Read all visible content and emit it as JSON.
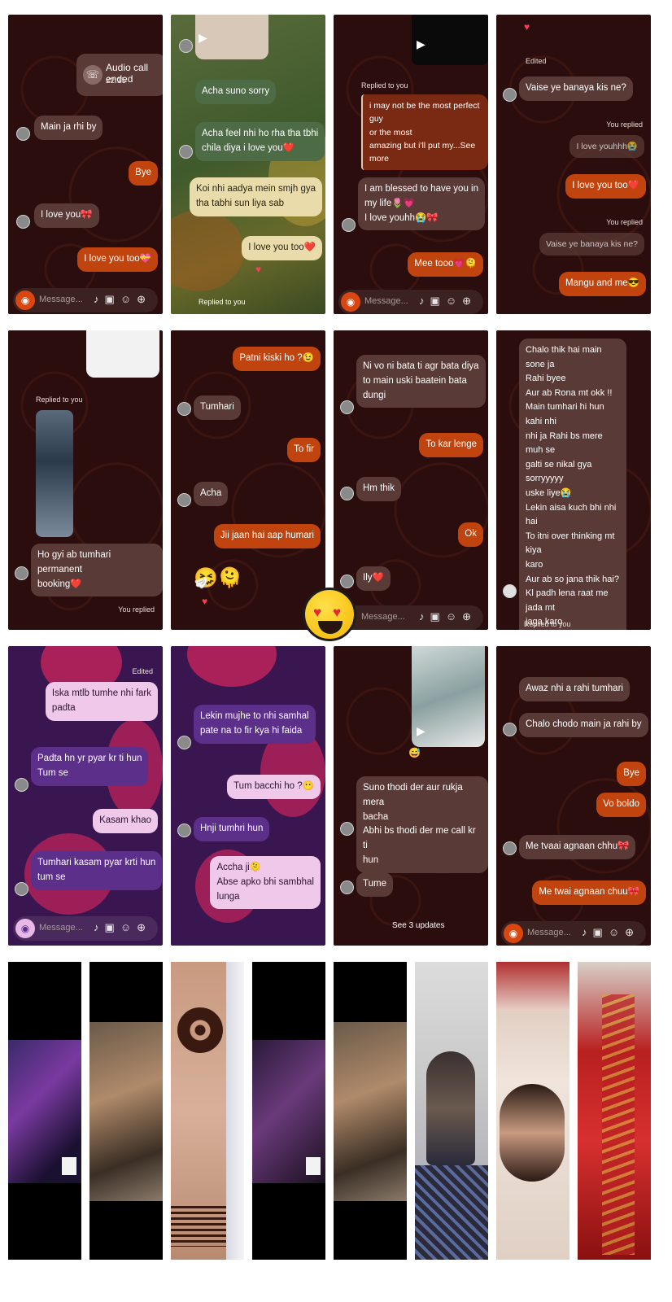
{
  "tile1": {
    "call_title": "Audio call ended",
    "call_time": "22:15",
    "m1": "Main ja rhi by",
    "m2": "Bye",
    "m3": "I love you🎀",
    "m4": "I love you too💝",
    "placeholder": "Message..."
  },
  "tile2": {
    "m1": "Acha suno sorry",
    "m2": "Acha feel nhi ho rha tha tbhi\nchila diya i love you❤️",
    "m3": "Koi nhi aadya mein smjh gya\ntha tabhi sun liya sab",
    "m4": "I love you too❤️",
    "replied": "Replied to you"
  },
  "tile3": {
    "replied": "Replied to you",
    "quote": "i may not be the most perfect guy\nor the most\namazing but i'll put my...See more",
    "m1": "I am blessed to have you in\nmy life🌷💗\nI love youhh😭🎀",
    "m2": "Mee tooo💗🫠",
    "placeholder": "Message..."
  },
  "tile4": {
    "edited": "Edited",
    "m1": "Vaise ye banaya kis ne?",
    "you_replied": "You replied",
    "q1": "I love youhhh😭",
    "m2": "I love you too❤️",
    "you_replied2": "You replied",
    "q2": "Vaise ye banaya kis ne?",
    "m3": "Mangu and me😎"
  },
  "tile5": {
    "replied": "Replied to you",
    "m1": "Ho gyi ab tumhari permanent\nbooking❤️",
    "you_replied": "You replied"
  },
  "tile6": {
    "m1": "Patni kiski ho ?😉",
    "m2": "Tumhari",
    "m3": "To fir",
    "m4": "Acha",
    "m5": "Jii jaan hai aap humari"
  },
  "tile7": {
    "m1": "Ni vo ni bata ti agr bata diya\nto main uski baatein bata\ndungi",
    "m2": "To kar lenge",
    "m3": "Hm thik",
    "m4": "Ok",
    "m5": "Ily❤️",
    "placeholder": "Message..."
  },
  "tile8": {
    "m1": "Chalo thik hai main sone ja\nRahi byee\nAur ab Rona mt okk !!\nMain tumhari hi hun kahi nhi\nnhi ja Rahi bs mere muh se\ngalti se nikal gya sorryyyyy\nuske liye😭\nLekin aisa kuch bhi nhi hai\nTo itni over thinking mt kiya\nkaro\nAur ab so jana thik hai?\nKl padh lena raat me jada mt\njaga karo\nChalo good night🌷",
    "replied": "Replied to you"
  },
  "tile9": {
    "edited": "Edited",
    "m1": "Iska mtlb tumhe nhi fark\npadta",
    "m2": "Padta hn yr pyar kr ti hun\nTum se",
    "m3": "Kasam khao",
    "m4": "Tumhari kasam pyar krti hun\ntum se",
    "placeholder": "Message..."
  },
  "tile10": {
    "m1": "Lekin mujhe to nhi samhal\npate na to fir kya hi faida",
    "m2": "Tum bacchi ho ?😶",
    "m3": "Hnji tumhri hun",
    "m4": "Accha ji🫠\nAbse apko bhi sambhal\nlunga"
  },
  "tile11": {
    "m1": "Suno thodi der aur rukja mera\nbacha\nAbhi bs thodi der me call kr ti\nhun",
    "m2": "Tume",
    "updates": "See 3 updates"
  },
  "tile12": {
    "m1": "Awaz nhi a rahi tumhari",
    "m2": "Chalo chodo main ja rahi by",
    "m3": "Bye",
    "m4": "Vo boldo",
    "m5": "Me tvaai agnaan chhu🎀",
    "m6": "Me twai agnaan chuu🎀",
    "placeholder": "Message..."
  },
  "photos": [
    "concert-selfie",
    "hands-bracelet",
    "henna-hand",
    "couple-dark",
    "hands-bracelet-2",
    "mirror-selfie",
    "glasses-selfie",
    "red-saree"
  ],
  "center_emoji": "heart-eyes-emoji",
  "colors": {
    "sent": "#c1440e",
    "received": "#5a3a36",
    "chat_bg": "#2a0d0c",
    "purple_bg": "#3a1650"
  }
}
